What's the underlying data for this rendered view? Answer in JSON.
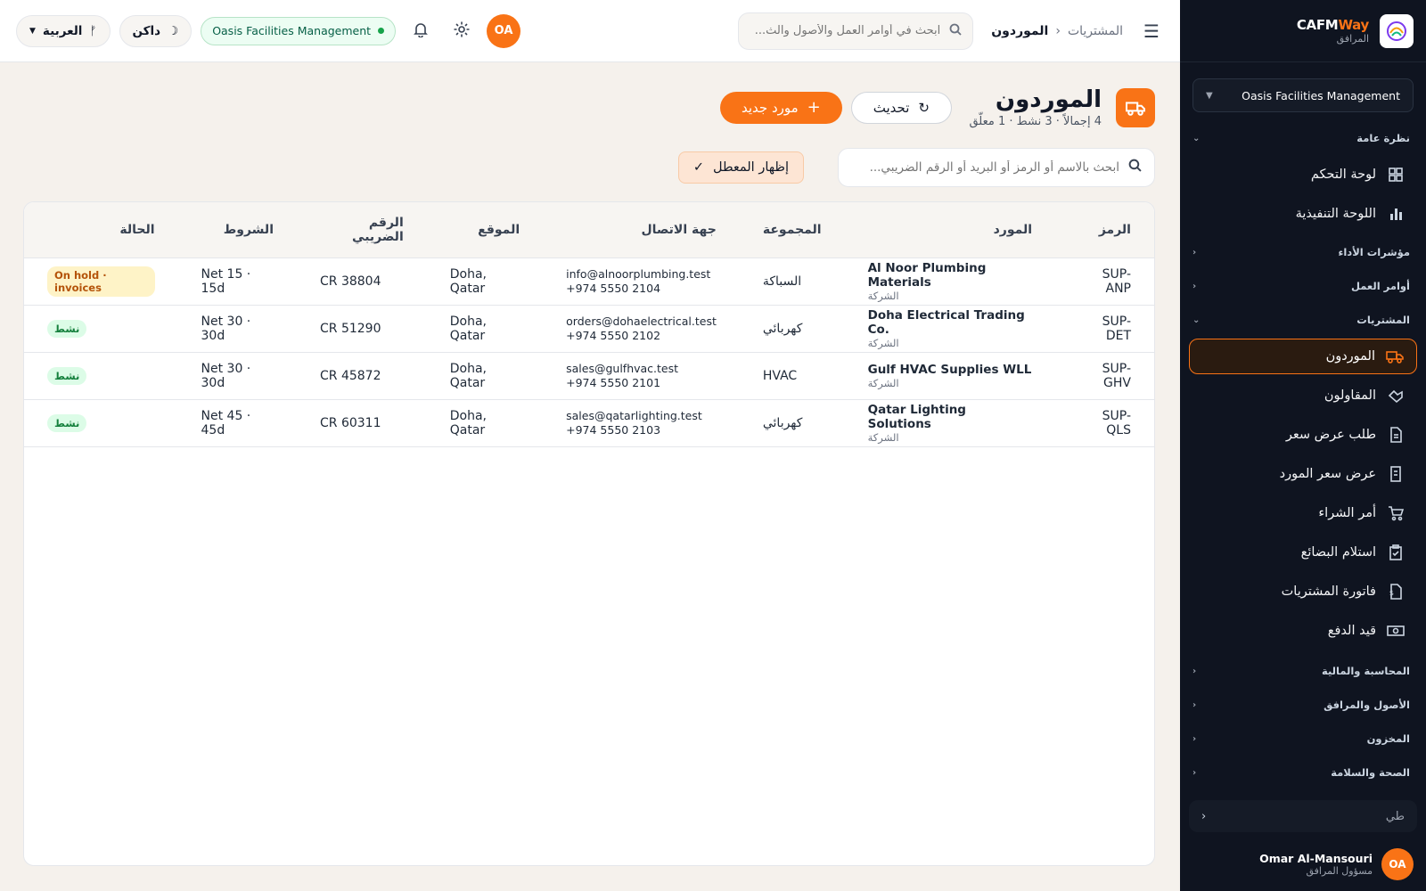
{
  "brand": {
    "name_a": "CAFM",
    "name_b": "Way",
    "sub": "المرافق"
  },
  "sidebar": {
    "org": "Oasis Facilities Management",
    "sections": [
      {
        "label": "نظرة عامة",
        "items": [
          {
            "label": "لوحة التحكم",
            "icon": "grid-icon"
          },
          {
            "label": "اللوحة التنفيذية",
            "icon": "bar-chart-icon"
          }
        ]
      },
      {
        "label": "مؤشرات الأداء"
      },
      {
        "label": "أوامر العمل"
      },
      {
        "label": "المشتريات",
        "items": [
          {
            "label": "الموردون",
            "icon": "truck-icon",
            "active": true
          },
          {
            "label": "المقاولون",
            "icon": "handshake-icon"
          },
          {
            "label": "طلب عرض سعر",
            "icon": "document-icon"
          },
          {
            "label": "عرض سعر المورد",
            "icon": "receipt-icon"
          },
          {
            "label": "أمر الشراء",
            "icon": "cart-icon"
          },
          {
            "label": "استلام البضائع",
            "icon": "clipboard-check-icon"
          },
          {
            "label": "فاتورة المشتريات",
            "icon": "invoice-icon"
          },
          {
            "label": "قيد الدفع",
            "icon": "cash-icon"
          }
        ]
      },
      {
        "label": "المحاسبة والمالية"
      },
      {
        "label": "الأصول والمرافق"
      },
      {
        "label": "المخزون"
      },
      {
        "label": "الصحة والسلامة"
      }
    ],
    "collapse_label": "طي",
    "user": {
      "initials": "OA",
      "name": "Omar Al-Mansouri",
      "role": "مسؤول المرافق"
    }
  },
  "topbar": {
    "breadcrumb": [
      "المشتريات",
      "الموردون"
    ],
    "search_placeholder": "ابحث في أوامر العمل والأصول والث...",
    "language": "العربية",
    "theme": "داكن",
    "org_pill": "Oasis Facilities Management",
    "avatar": "OA"
  },
  "page": {
    "title": "الموردون",
    "subtitle": "4 إجمالاً · 3 نشط · 1 معلّق",
    "refresh_label": "تحديث",
    "new_label": "مورد جديد",
    "search_placeholder": "ابحث بالاسم أو الرمز أو البريد أو الرقم الضريبي...",
    "show_disabled_label": "إظهار المعطل"
  },
  "table": {
    "headers": [
      "الرمز",
      "المورد",
      "المجموعة",
      "جهة الاتصال",
      "الموقع",
      "الرقم الضريبي",
      "الشروط",
      "الحالة"
    ],
    "rows": [
      {
        "code": "SUP-ANP",
        "name": "Al Noor Plumbing Materials",
        "type": "الشركة",
        "group": "السباكة",
        "email": "info@alnoorplumbing.test",
        "phone": "+974 5550 2104",
        "location": "Doha, Qatar",
        "tax": "CR 38804",
        "terms": "Net 15 · 15d",
        "status": "On hold · invoices",
        "status_kind": "hold"
      },
      {
        "code": "SUP-DET",
        "name": "Doha Electrical Trading Co.",
        "type": "الشركة",
        "group": "كهربائي",
        "email": "orders@dohaelectrical.test",
        "phone": "+974 5550 2102",
        "location": "Doha, Qatar",
        "tax": "CR 51290",
        "terms": "Net 30 · 30d",
        "status": "نشط",
        "status_kind": "ok"
      },
      {
        "code": "SUP-GHV",
        "name": "Gulf HVAC Supplies WLL",
        "type": "الشركة",
        "group": "HVAC",
        "email": "sales@gulfhvac.test",
        "phone": "+974 5550 2101",
        "location": "Doha, Qatar",
        "tax": "CR 45872",
        "terms": "Net 30 · 30d",
        "status": "نشط",
        "status_kind": "ok"
      },
      {
        "code": "SUP-QLS",
        "name": "Qatar Lighting Solutions",
        "type": "الشركة",
        "group": "كهربائي",
        "email": "sales@qatarlighting.test",
        "phone": "+974 5550 2103",
        "location": "Doha, Qatar",
        "tax": "CR 60311",
        "terms": "Net 45 · 45d",
        "status": "نشط",
        "status_kind": "ok"
      }
    ]
  },
  "colors": {
    "accent": "#f97316",
    "sidebar_bg": "#0f1420",
    "active_ok": "#15803d",
    "hold": "#b45309"
  }
}
